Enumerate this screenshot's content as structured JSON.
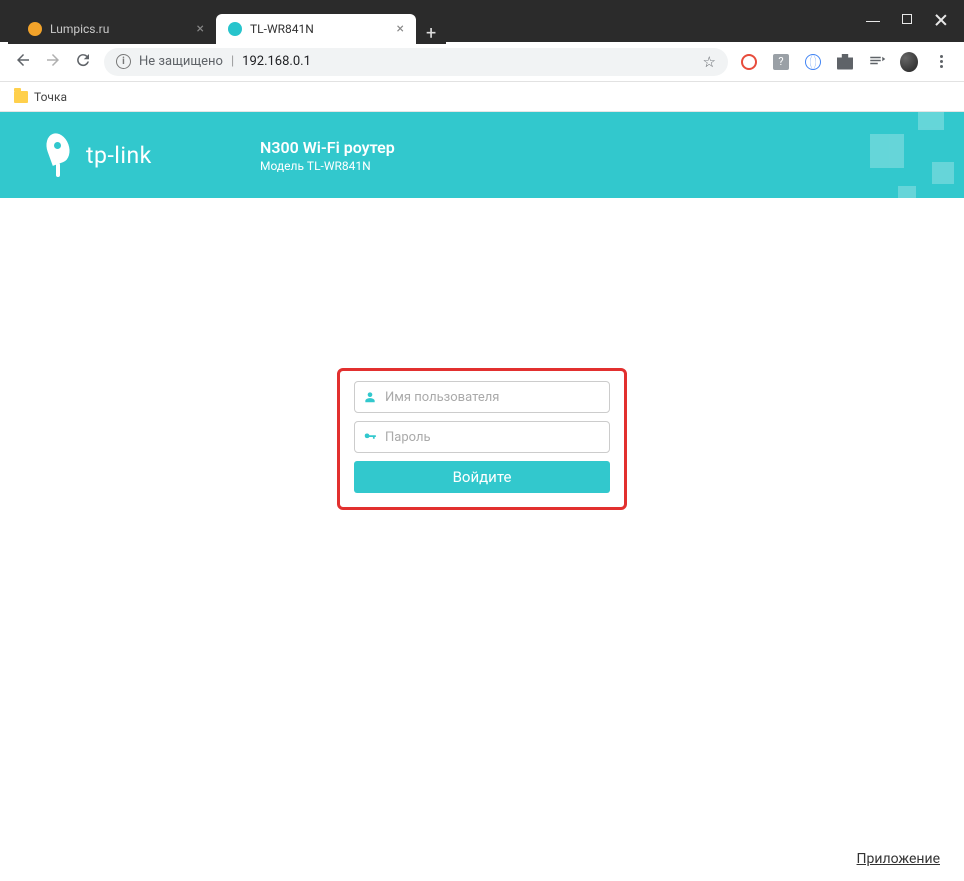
{
  "browser": {
    "tabs": [
      {
        "title": "Lumpics.ru",
        "active": false,
        "faviconColor": "orange"
      },
      {
        "title": "TL-WR841N",
        "active": true,
        "faviconColor": "teal"
      }
    ],
    "security_label": "Не защищено",
    "url": "192.168.0.1"
  },
  "bookmarks": {
    "item0": "Точка"
  },
  "header": {
    "brand": "tp-link",
    "product_title": "N300 Wi-Fi роутер",
    "product_model": "Модель TL-WR841N"
  },
  "login": {
    "username_placeholder": "Имя пользователя",
    "password_placeholder": "Пароль",
    "submit_label": "Войдите"
  },
  "footer": {
    "app_link": "Приложение"
  }
}
